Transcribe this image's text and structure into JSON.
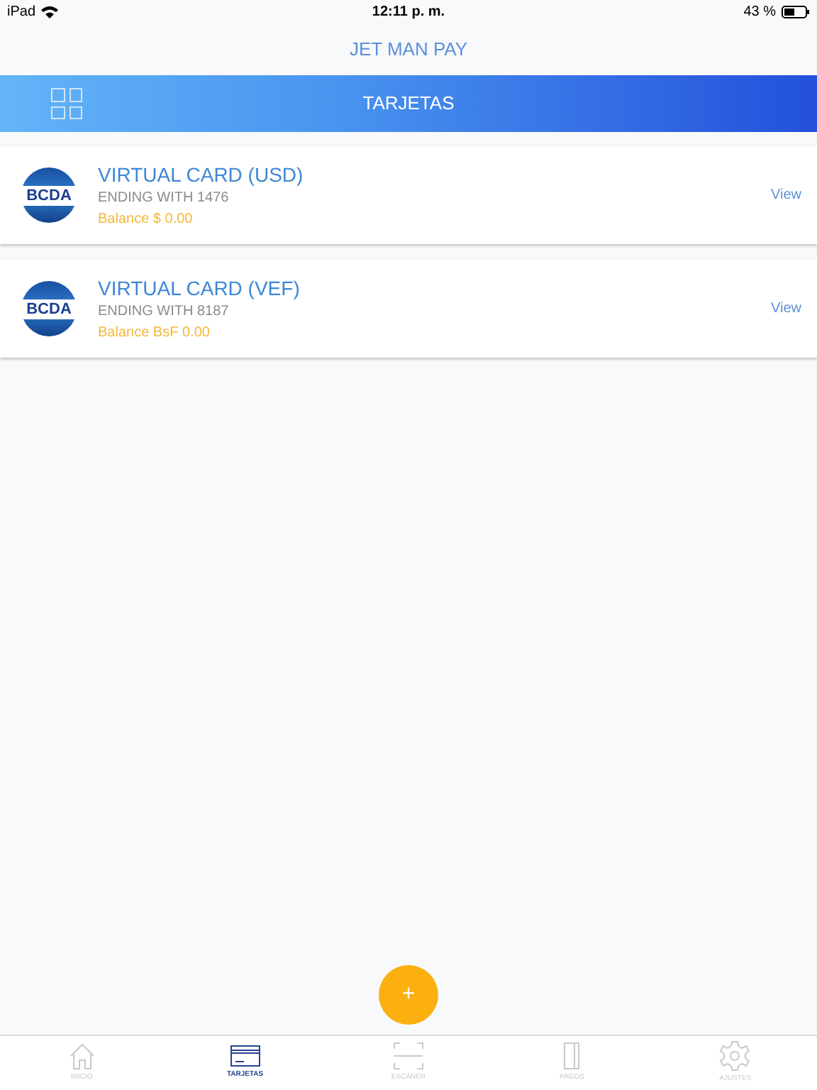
{
  "status_bar": {
    "device": "iPad",
    "time": "12:11 p. m.",
    "battery": "43 %"
  },
  "app_title": "JET MAN PAY",
  "header": {
    "title": "TARJETAS"
  },
  "cards": [
    {
      "logo_text": "BCDA",
      "title": "VIRTUAL CARD (USD)",
      "ending": "ENDING WITH 1476",
      "balance": "Balance $ 0.00",
      "action": "View"
    },
    {
      "logo_text": "BCDA",
      "title": "VIRTUAL CARD (VEF)",
      "ending": "ENDING WITH 8187",
      "balance": "Balance BsF 0.00",
      "action": "View"
    }
  ],
  "fab": {
    "label": "+"
  },
  "tab_bar": [
    {
      "kind": "home",
      "label": "INICIO",
      "selected": false
    },
    {
      "kind": "card",
      "label": "TARJETAS",
      "selected": true
    },
    {
      "kind": "scan",
      "label": "ESCÁNER",
      "selected": false
    },
    {
      "kind": "pay",
      "label": "PAGOS",
      "selected": false
    },
    {
      "kind": "settings",
      "label": "AJUSTES",
      "selected": false
    }
  ]
}
